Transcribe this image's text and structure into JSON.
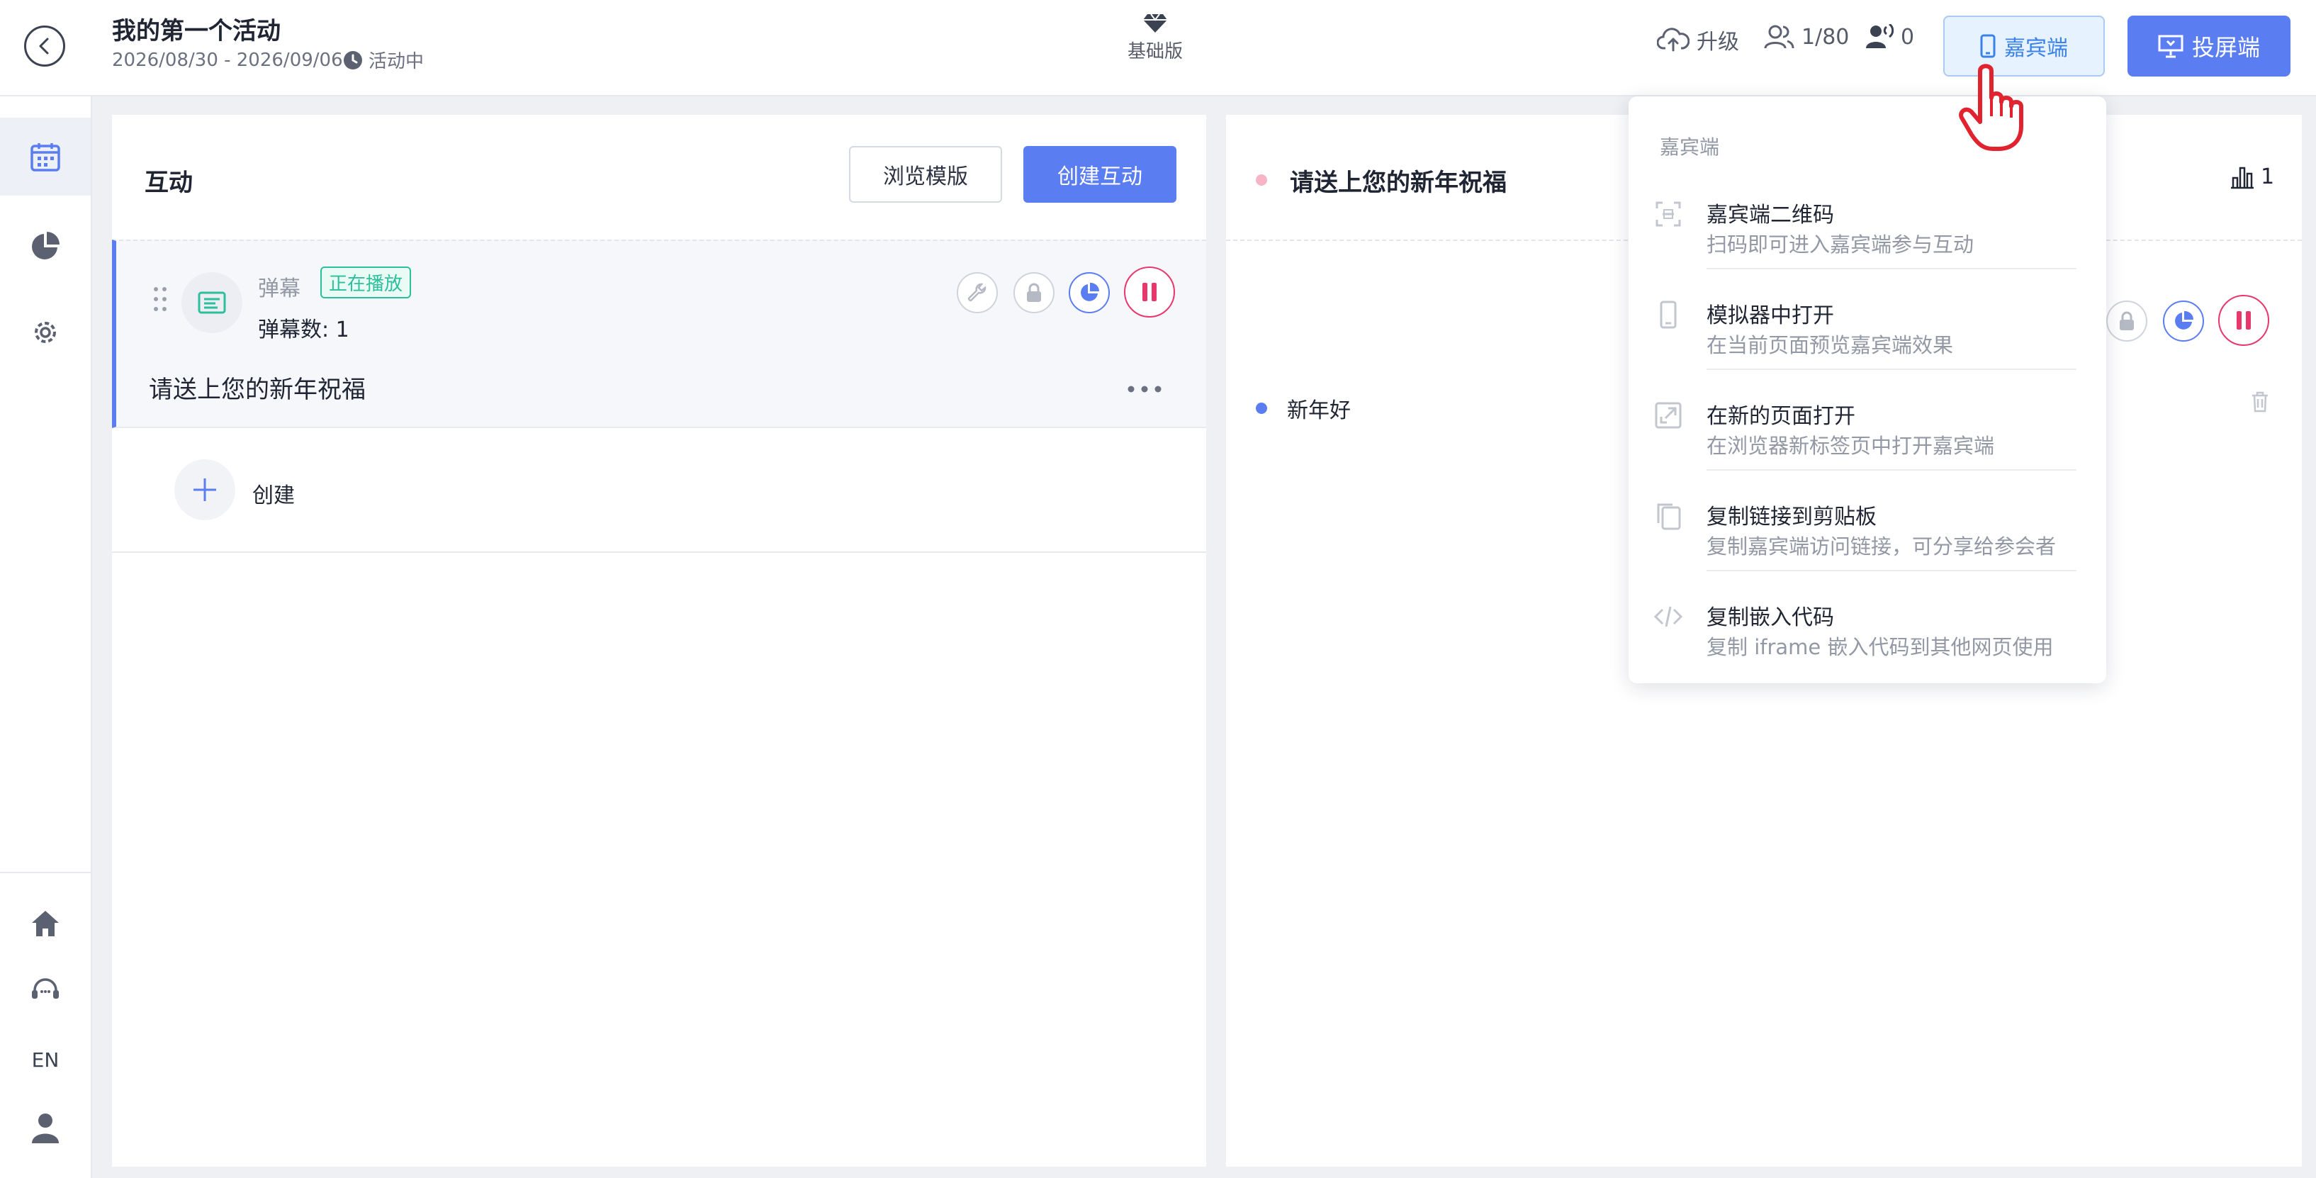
{
  "header": {
    "title": "我的第一个活动",
    "dates": "2026/08/30 - 2026/09/06",
    "status": "活动中",
    "plan": "基础版",
    "upgrade": "升级",
    "participants": "1/80",
    "online": "0",
    "guest_button": "嘉宾端",
    "screen_button": "投屏端"
  },
  "sidebar": {
    "items": [
      "calendar-icon",
      "pie-chart-icon",
      "gear-icon"
    ],
    "bottom": [
      "home-icon",
      "support-icon",
      "EN",
      "user-icon"
    ],
    "lang": "EN"
  },
  "left": {
    "title": "互动",
    "browse_button": "浏览模版",
    "create_button": "创建互动",
    "card": {
      "type": "弹幕",
      "badge": "正在播放",
      "count": "弹幕数: 1",
      "name": "请送上您的新年祝福"
    },
    "create_label": "创建"
  },
  "right": {
    "title": "请送上您的新年祝福",
    "stat": "1",
    "message": "新年好"
  },
  "dropdown": {
    "header": "嘉宾端",
    "items": [
      {
        "title": "嘉宾端二维码",
        "desc": "扫码即可进入嘉宾端参与互动",
        "icon": "qr-code-icon"
      },
      {
        "title": "模拟器中打开",
        "desc": "在当前页面预览嘉宾端效果",
        "icon": "phone-icon"
      },
      {
        "title": "在新的页面打开",
        "desc": "在浏览器新标签页中打开嘉宾端",
        "icon": "external-link-icon"
      },
      {
        "title": "复制链接到剪贴板",
        "desc": "复制嘉宾端访问链接，可分享给参会者",
        "icon": "copy-icon"
      },
      {
        "title": "复制嵌入代码",
        "desc": "复制 iframe 嵌入代码到其他网页使用",
        "icon": "code-icon"
      }
    ]
  },
  "colors": {
    "accent": "#5b7df2",
    "guest_bg": "#e7f2ff",
    "pause_red": "#e8376b",
    "badge_green": "#2bbf9c"
  }
}
